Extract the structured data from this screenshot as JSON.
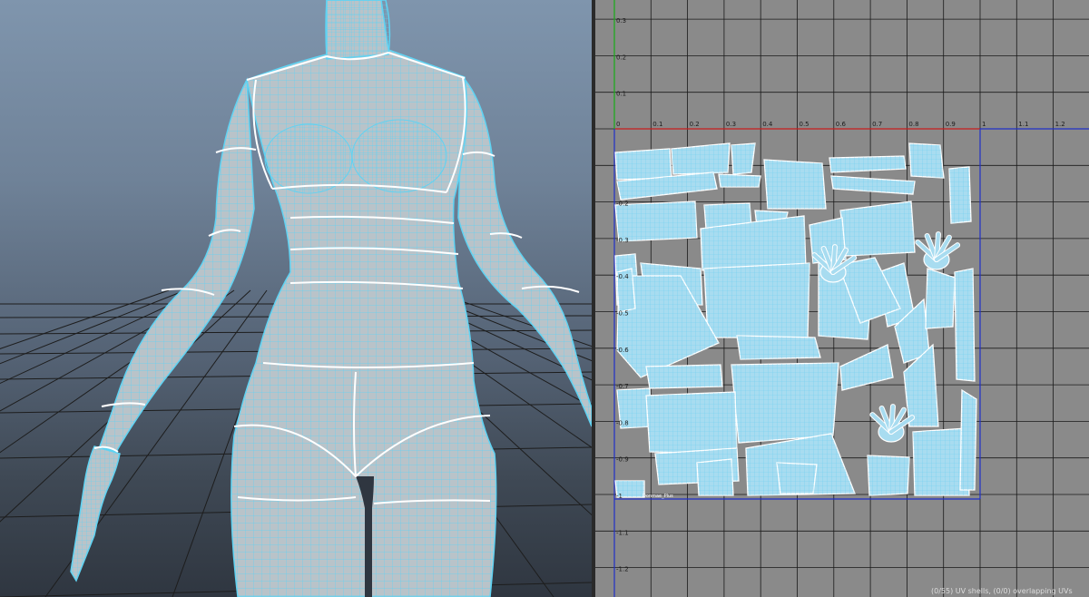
{
  "viewport3d": {
    "colors": {
      "mesh_fill": "#b9c3c9",
      "wire": "#5fd3f3",
      "seam": "#ffffff",
      "floor_grid": "#1d1d1d"
    }
  },
  "uv_editor": {
    "axis_labels_u": [
      "0",
      "0.1",
      "0.2",
      "0.3",
      "0.4",
      "0.5",
      "0.6",
      "0.7",
      "0.8",
      "0.9",
      "1",
      "1.1",
      "1.2"
    ],
    "axis_labels_v_top": [
      "0.3",
      "0.2",
      "0.1"
    ],
    "axis_labels_v_left": [
      "-0.2",
      "-0.3",
      "-0.4",
      "-0.5",
      "-0.6",
      "-0.7",
      "-0.8",
      "-0.9",
      "-1",
      "-1.1",
      "-1.2"
    ],
    "status_text": "(0/55) UV shells, (0/0) overlapping UVs",
    "shell_badge_text": "Donmae_Plus",
    "colors": {
      "background": "#8a8a8a",
      "grid": "#1a1a1a",
      "u_axis": "#c81e1e",
      "v_axis": "#1faa1f",
      "border": "#2030c8",
      "shell_fill": "#a8dcf0",
      "shell_wire": "#6fd0f0",
      "shell_edge": "#ffffff"
    }
  }
}
